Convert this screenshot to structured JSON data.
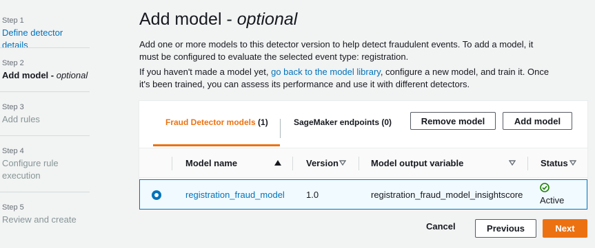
{
  "stepper": {
    "steps": [
      {
        "number": "Step 1",
        "title": "Define detector details"
      },
      {
        "number": "Step 2",
        "title": "Add model - ",
        "title_em": "optional"
      },
      {
        "number": "Step 3",
        "title": "Add rules"
      },
      {
        "number": "Step 4",
        "title_line1": "Configure rule",
        "title_line2": "execution"
      },
      {
        "number": "Step 5",
        "title": "Review and create"
      }
    ]
  },
  "page": {
    "title": "Add model - ",
    "title_em": "optional",
    "desc1": "Add one or more models to this detector version to help detect fraudulent events. To add a model, it must be configured to evaluate the selected event type: registration.",
    "desc2_before": "If you haven't made a model yet, ",
    "desc2_link": "go back to the model library",
    "desc2_after": ", configure a new model, and train it. Once it's been trained, you can assess its performance and use it with different detectors."
  },
  "tabs": [
    {
      "label": "Fraud Detector models",
      "count": "(1)"
    },
    {
      "label": "SageMaker endpoints",
      "count": "(0)"
    }
  ],
  "actions": {
    "remove_model": "Remove model",
    "add_model": "Add model"
  },
  "table": {
    "columns": [
      "Model name",
      "Version",
      "Model output variable",
      "Status"
    ],
    "rows": [
      {
        "model_name": "registration_fraud_model",
        "version": "1.0",
        "output_variable": "registration_fraud_model_insightscore",
        "status": "Active"
      }
    ]
  },
  "footer": {
    "cancel": "Cancel",
    "previous": "Previous",
    "next": "Next"
  },
  "colors": {
    "accent": "#ec7211",
    "link": "#0073bb",
    "success": "#1d8102"
  }
}
